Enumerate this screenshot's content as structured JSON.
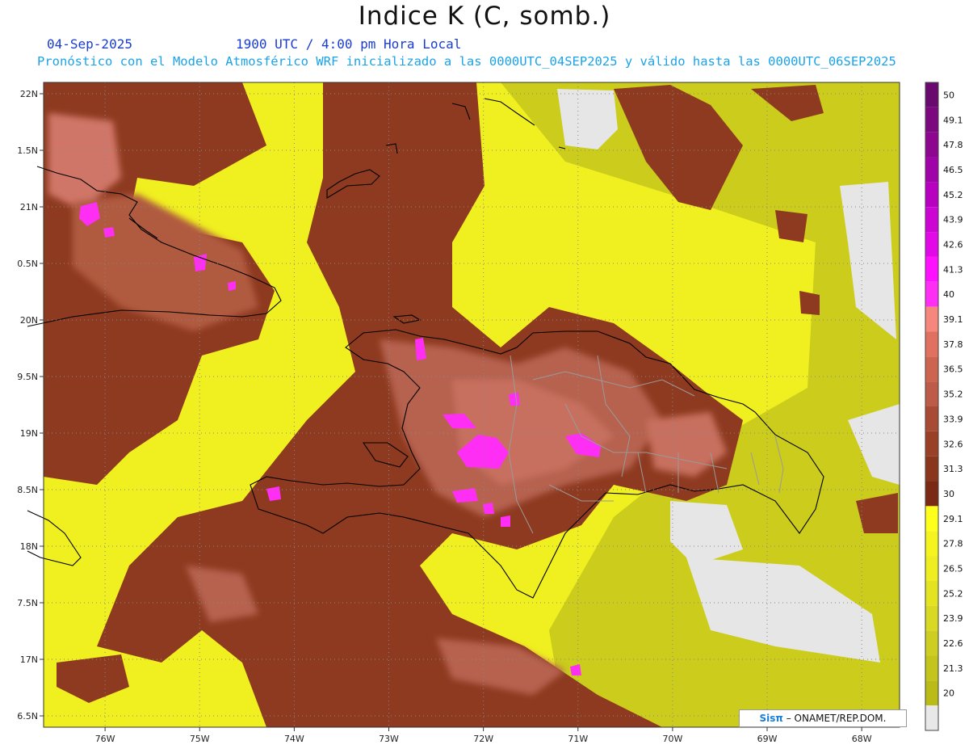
{
  "header": {
    "title": "Indice K (C, somb.)",
    "date": "04-Sep-2025",
    "time": "1900 UTC / 4:00 pm Hora Local",
    "subtitle": "Pronóstico con el Modelo Atmosférico WRF inicializado a las 0000UTC_04SEP2025 y válido hasta las  0000UTC_06SEP2025"
  },
  "map": {
    "lon_range": [
      -76.65,
      -67.6
    ],
    "lat_range": [
      16.4,
      22.1
    ],
    "lon_ticks": [
      "76W",
      "75W",
      "74W",
      "73W",
      "72W",
      "71W",
      "70W",
      "69W",
      "68W"
    ],
    "lon_values": [
      -76,
      -75,
      -74,
      -73,
      -72,
      -71,
      -70,
      -69,
      -68
    ],
    "lat_ticks": [
      "6.5N",
      "17N",
      "7.5N",
      "18N",
      "8.5N",
      "19N",
      "9.5N",
      "20N",
      "0.5N",
      "21N",
      "1.5N",
      "22N"
    ],
    "lat_values": [
      16.5,
      17,
      17.5,
      18,
      18.5,
      19,
      19.5,
      20,
      20.5,
      21,
      21.5,
      22
    ],
    "colors": {
      "background": "#f0ef20",
      "land_base": "#c4c51c",
      "brown": "#8e3a20",
      "brown_light": "#b05a40",
      "pink": "#c8705e",
      "magenta": "#ff2ef4",
      "gray": "#e6e6e6",
      "coast": "#000000",
      "borders": "#9a9a9a"
    }
  },
  "colorbar": {
    "labels": [
      "50",
      "49.1",
      "47.8",
      "46.5",
      "45.2",
      "43.9",
      "42.6",
      "41.3",
      "40",
      "39.1",
      "37.8",
      "36.5",
      "35.2",
      "33.9",
      "32.6",
      "31.3",
      "30",
      "29.1",
      "27.8",
      "26.5",
      "25.2",
      "23.9",
      "22.6",
      "21.3",
      "20"
    ],
    "colors": [
      "#6a0a6e",
      "#7c0880",
      "#8c0690",
      "#a004a8",
      "#b800c0",
      "#cc04d4",
      "#e208e8",
      "#ff10ff",
      "#ff2ef4",
      "#f5877c",
      "#e07060",
      "#cc6450",
      "#bd5a48",
      "#a84a34",
      "#9a4026",
      "#8a361c",
      "#7a2a14",
      "#ffff1c",
      "#f6f41e",
      "#eded20",
      "#e4e322",
      "#d9d822",
      "#cece22",
      "#c4c51c",
      "#bbbb18",
      "#e8e8e8"
    ]
  },
  "credit": {
    "brand": "Sisπ",
    "text": " – ONAMET/REP.DOM."
  }
}
